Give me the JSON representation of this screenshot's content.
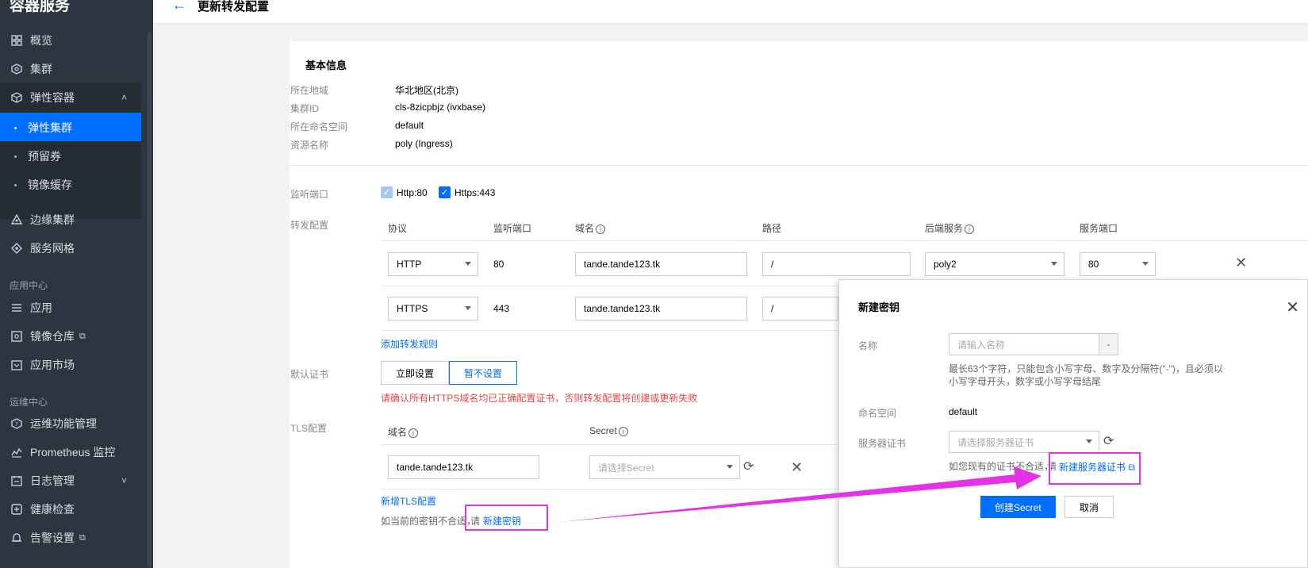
{
  "sidebar": {
    "title": "容器服务",
    "items": [
      {
        "label": "概览",
        "icon": "grid-icon"
      },
      {
        "label": "集群",
        "icon": "cluster-icon"
      },
      {
        "label": "弹性容器",
        "icon": "elastic-icon",
        "caret": "˄"
      },
      {
        "label": "边缘集群",
        "icon": "edge-icon"
      },
      {
        "label": "服务网格",
        "icon": "mesh-icon"
      }
    ],
    "sub_items": [
      "弹性集群",
      "预留券",
      "镜像缓存"
    ],
    "section_app": "应用中心",
    "app_items": [
      {
        "label": "应用",
        "icon": "app-icon"
      },
      {
        "label": "镜像仓库",
        "icon": "image-repo-icon",
        "ext": "⧉"
      },
      {
        "label": "应用市场",
        "icon": "market-icon"
      }
    ],
    "section_ops": "运维中心",
    "ops_items": [
      {
        "label": "运维功能管理",
        "icon": "ops-icon"
      },
      {
        "label": "Prometheus 监控",
        "icon": "prometheus-icon"
      },
      {
        "label": "日志管理",
        "icon": "log-icon",
        "caret": "˅"
      },
      {
        "label": "健康检查",
        "icon": "health-icon"
      },
      {
        "label": "告警设置",
        "icon": "alarm-icon",
        "ext": "⧉"
      }
    ]
  },
  "header": {
    "back": "←",
    "title": "更新转发配置"
  },
  "basic": {
    "title": "基本信息",
    "region_label": "所在地域",
    "region": "华北地区(北京)",
    "cluster_label": "集群ID",
    "cluster": "cls-8zicpbjz (ivxbase)",
    "ns_label": "所在命名空间",
    "ns": "default",
    "res_label": "资源名称",
    "res": "poly (Ingress)"
  },
  "listen": {
    "label": "监听端口",
    "http": "Http:80",
    "https": "Https:443"
  },
  "forward": {
    "label": "转发配置",
    "headers": [
      "协议",
      "监听端口",
      "域名",
      "路径",
      "后端服务",
      "服务端口"
    ],
    "rows": [
      {
        "protocol": "HTTP",
        "port": "80",
        "domain": "tande.tande123.tk",
        "path": "/",
        "backend": "poly2",
        "svc_port": "80"
      },
      {
        "protocol": "HTTPS",
        "port": "443",
        "domain": "tande.tande123.tk",
        "path": "/"
      }
    ],
    "add_rule": "添加转发规则"
  },
  "cert": {
    "label": "默认证书",
    "opt_now": "立即设置",
    "opt_none": "暂不设置",
    "warning": "请确认所有HTTPS域名均已正确配置证书，否则转发配置将创建或更新失败"
  },
  "tls": {
    "label": "TLS配置",
    "h_domain": "域名",
    "h_secret": "Secret",
    "domain": "tande.tande123.tk",
    "secret_placeholder": "请选择Secret",
    "add": "新增TLS配置",
    "hint": "如当前的密钥不合适，",
    "hint_please": "请",
    "hint_link": "新建密钥"
  },
  "dialog": {
    "title": "新建密钥",
    "name_label": "名称",
    "name_placeholder": "请输入名称",
    "name_suffix": "-",
    "name_hint_1": "最长63个字符，只能包含小写字母、数字及分隔符(\"-\")，且必须以",
    "name_hint_2": "小写字母开头，数字或小写字母结尾",
    "ns_label": "命名空间",
    "ns": "default",
    "cert_label": "服务器证书",
    "cert_placeholder": "请选择服务器证书",
    "cert_hint": "如您现有的证书不合适，",
    "cert_hint_please": "请",
    "cert_link": "新建服务器证书",
    "create": "创建Secret",
    "cancel": "取消"
  },
  "colors": {
    "accent": "#006eff",
    "highlight": "#e632e6",
    "warning": "#e54545",
    "sidebar": "#2d3541"
  }
}
